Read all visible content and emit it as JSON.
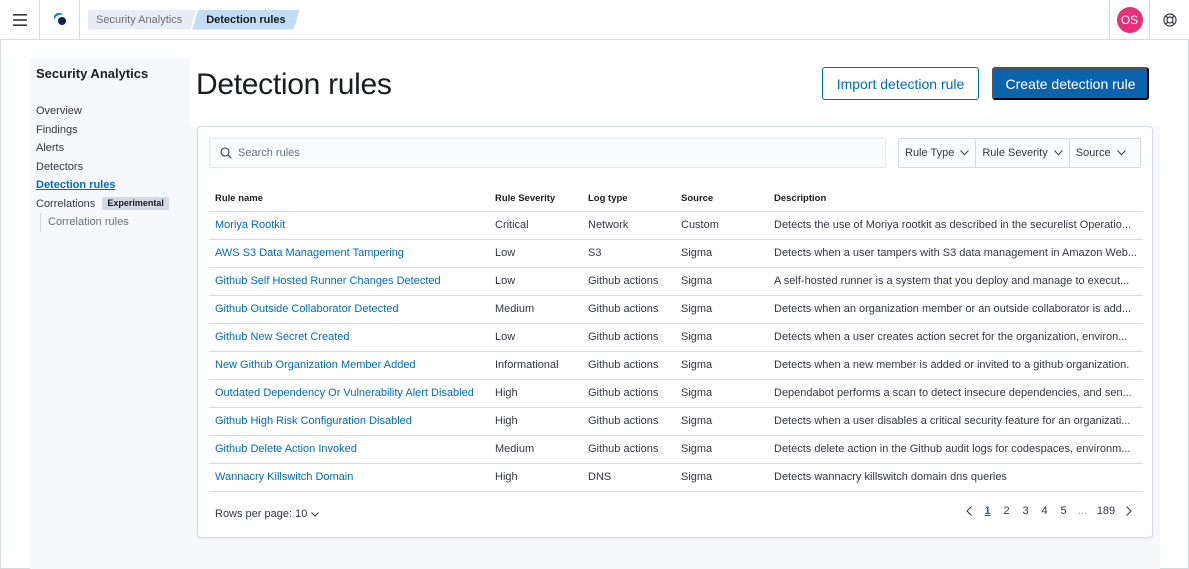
{
  "header": {
    "breadcrumbs": [
      "Security Analytics",
      "Detection rules"
    ],
    "avatar_initials": "OS"
  },
  "sidenav": {
    "title": "Security Analytics",
    "items": [
      "Overview",
      "Findings",
      "Alerts",
      "Detectors",
      "Detection rules"
    ],
    "active_item": "Detection rules",
    "correlations_label": "Correlations",
    "correlations_badge": "Experimental",
    "sub_items": [
      "Correlation rules"
    ]
  },
  "page": {
    "title": "Detection rules",
    "import_button": "Import detection rule",
    "create_button": "Create detection rule"
  },
  "search": {
    "placeholder": "Search rules"
  },
  "filters": [
    "Rule Type",
    "Rule Severity",
    "Source"
  ],
  "table": {
    "columns": [
      "Rule name",
      "Rule Severity",
      "Log type",
      "Source",
      "Description"
    ],
    "rows": [
      [
        "Moriya Rootkit",
        "Critical",
        "Network",
        "Custom",
        "Detects the use of Moriya rootkit as described in the securelist Operatio..."
      ],
      [
        "AWS S3 Data Management Tampering",
        "Low",
        "S3",
        "Sigma",
        "Detects when a user tampers with S3 data management in Amazon Web..."
      ],
      [
        "Github Self Hosted Runner Changes Detected",
        "Low",
        "Github actions",
        "Sigma",
        "A self-hosted runner is a system that you deploy and manage to execut..."
      ],
      [
        "Github Outside Collaborator Detected",
        "Medium",
        "Github actions",
        "Sigma",
        "Detects when an organization member or an outside collaborator is add..."
      ],
      [
        "Github New Secret Created",
        "Low",
        "Github actions",
        "Sigma",
        "Detects when a user creates action secret for the organization, environ..."
      ],
      [
        "New Github Organization Member Added",
        "Informational",
        "Github actions",
        "Sigma",
        "Detects when a new member is added or invited to a github organization."
      ],
      [
        "Outdated Dependency Or Vulnerability Alert Disabled",
        "High",
        "Github actions",
        "Sigma",
        "Dependabot performs a scan to detect insecure dependencies, and sen..."
      ],
      [
        "Github High Risk Configuration Disabled",
        "High",
        "Github actions",
        "Sigma",
        "Detects when a user disables a critical security feature for an organizati..."
      ],
      [
        "Github Delete Action Invoked",
        "Medium",
        "Github actions",
        "Sigma",
        "Detects delete action in the Github audit logs for codespaces, environm..."
      ],
      [
        "Wannacry Killswitch Domain",
        "High",
        "DNS",
        "Sigma",
        "Detects wannacry killswitch domain dns queries"
      ]
    ]
  },
  "footer": {
    "rows_per_page": "Rows per page: 10",
    "pages": [
      "1",
      "2",
      "3",
      "4",
      "5"
    ],
    "ellipsis": "...",
    "last_page": "189",
    "current_page": "1"
  },
  "colors": {
    "link": "#006bb8",
    "primary_button": "#0b64ab",
    "avatar": "#e7307b",
    "breadcrumb_active": "#c2dcf3"
  }
}
